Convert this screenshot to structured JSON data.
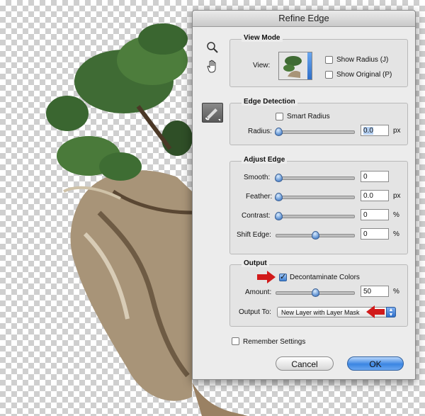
{
  "dialog": {
    "title": "Refine Edge",
    "tools": {
      "zoom": "zoom-icon",
      "hand": "hand-icon",
      "refine": "refine-radius-brush-icon"
    },
    "view_mode": {
      "title": "View Mode",
      "view_label": "View:",
      "show_radius_label": "Show Radius (J)",
      "show_radius_checked": false,
      "show_original_label": "Show Original (P)",
      "show_original_checked": false
    },
    "edge_detection": {
      "title": "Edge Detection",
      "smart_radius_label": "Smart Radius",
      "smart_radius_checked": false,
      "radius_label": "Radius:",
      "radius_value": "0.0",
      "radius_unit": "px"
    },
    "adjust_edge": {
      "title": "Adjust Edge",
      "smooth_label": "Smooth:",
      "smooth_value": "0",
      "feather_label": "Feather:",
      "feather_value": "0.0",
      "feather_unit": "px",
      "contrast_label": "Contrast:",
      "contrast_value": "0",
      "contrast_unit": "%",
      "shift_label": "Shift Edge:",
      "shift_value": "0",
      "shift_unit": "%"
    },
    "output": {
      "title": "Output",
      "decontaminate_label": "Decontaminate Colors",
      "decontaminate_checked": true,
      "amount_label": "Amount:",
      "amount_value": "50",
      "amount_unit": "%",
      "output_to_label": "Output To:",
      "output_to_value": "New Layer with Layer Mask"
    },
    "remember_label": "Remember Settings",
    "remember_checked": false,
    "cancel_label": "Cancel",
    "ok_label": "OK"
  },
  "colors": {
    "accent": "#3b85e2",
    "annotation_arrow": "#d11a1a"
  }
}
